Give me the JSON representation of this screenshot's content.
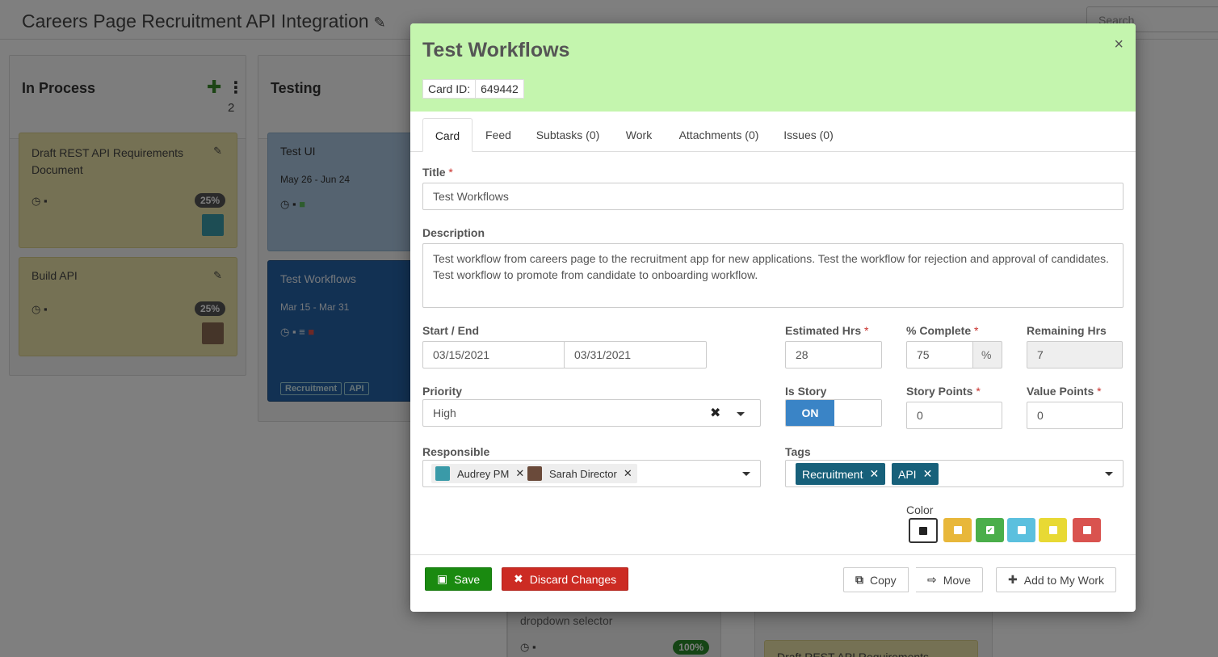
{
  "background": {
    "page_title": "Careers Page Recruitment API Integration",
    "search_placeholder": "Search",
    "columns": [
      {
        "title": "In Process",
        "count": "2"
      },
      {
        "title": "Testing"
      }
    ],
    "cards": [
      {
        "title": "Draft REST API Requirements Document",
        "percent": "25%"
      },
      {
        "title": "Build API",
        "percent": "25%"
      },
      {
        "title": "Test UI",
        "dates": "May 26 - Jun 24"
      },
      {
        "title": "Test Workflows",
        "dates": "Mar 15 - Mar 31",
        "tags": [
          "Recruitment",
          "API"
        ]
      },
      {
        "title": "dropdown selector",
        "percent": "100%"
      },
      {
        "title": "Draft REST API Requirements"
      }
    ]
  },
  "modal": {
    "title": "Test Workflows",
    "card_id_label": "Card ID:",
    "card_id": "649442",
    "close": "×",
    "tabs": [
      {
        "label": "Card"
      },
      {
        "label": "Feed"
      },
      {
        "label": "Subtasks (0)"
      },
      {
        "label": "Work"
      },
      {
        "label": "Attachments (0)"
      },
      {
        "label": "Issues (0)"
      }
    ],
    "fields": {
      "title_label": "Title",
      "title_value": "Test Workflows",
      "description_label": "Description",
      "description_value": "Test workflow from careers page to the recruitment app for new applications.  Test the workflow for rejection and approval of candidates.  Test workflow to promote from candidate to onboarding workflow.",
      "start_end_label": "Start / End",
      "start_value": "03/15/2021",
      "end_value": "03/31/2021",
      "estimated_label": "Estimated Hrs",
      "estimated_value": "28",
      "complete_label": "% Complete",
      "complete_value": "75",
      "complete_addon": "%",
      "remaining_label": "Remaining Hrs",
      "remaining_value": "7",
      "priority_label": "Priority",
      "priority_value": "High",
      "is_story_label": "Is Story",
      "is_story_value": "ON",
      "story_points_label": "Story Points",
      "story_points_value": "0",
      "value_points_label": "Value Points",
      "value_points_value": "0",
      "responsible_label": "Responsible",
      "responsible": [
        "Audrey PM",
        "Sarah Director"
      ],
      "tags_label": "Tags",
      "tags": [
        "Recruitment",
        "API"
      ],
      "color_label": "Color",
      "colors": [
        "#ffffff",
        "#e8b73a",
        "#4aae4a",
        "#5bc0de",
        "#e8d934",
        "#d9534f"
      ],
      "required_mark": "*"
    },
    "buttons": {
      "save": "Save",
      "discard": "Discard Changes",
      "copy": "Copy",
      "move": "Move",
      "add_to_work": "Add to My Work"
    }
  }
}
